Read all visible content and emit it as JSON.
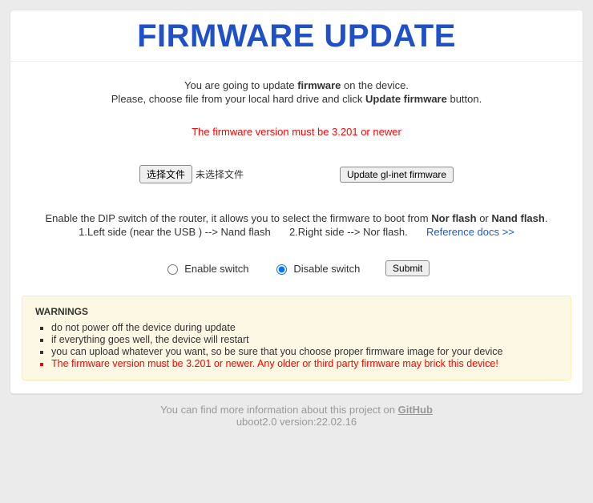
{
  "title": "FIRMWARE UPDATE",
  "intro": {
    "line1_prefix": "You are going to update ",
    "line1_bold": "firmware",
    "line1_suffix": " on the device.",
    "line2_prefix": "Please, choose file from your local hard drive and click ",
    "line2_bold": "Update firmware",
    "line2_suffix": " button."
  },
  "notice": "The firmware version must be 3.201 or newer",
  "file": {
    "button_label": "选择文件",
    "status": "未选择文件"
  },
  "update_button_label": "Update gl-inet firmware",
  "dip": {
    "line1_prefix": "Enable the DIP switch of the router, it allows you to select the firmware to boot from ",
    "bold1": "Nor flash",
    "mid": " or ",
    "bold2": "Nand flash",
    "suffix": ".",
    "line2_left": "1.Left side (near the USB ) --> Nand flash",
    "line2_right": "2.Right side --> Nor flash.",
    "ref_link": "Reference docs >>"
  },
  "switch": {
    "enable_label": "Enable switch",
    "disable_label": "Disable switch",
    "submit_label": "Submit"
  },
  "warnings": {
    "title": "WARNINGS",
    "items": [
      "do not power off the device during update",
      "if everything goes well, the device will restart",
      "you can upload whatever you want, so be sure that you choose proper firmware image for your device",
      "The firmware version must be 3.201 or newer. Any older or third party firmware may brick this device!"
    ]
  },
  "footer": {
    "text_prefix": "You can find more information about this project on ",
    "link_label": "GitHub",
    "version": "uboot2.0 version:22.02.16"
  }
}
